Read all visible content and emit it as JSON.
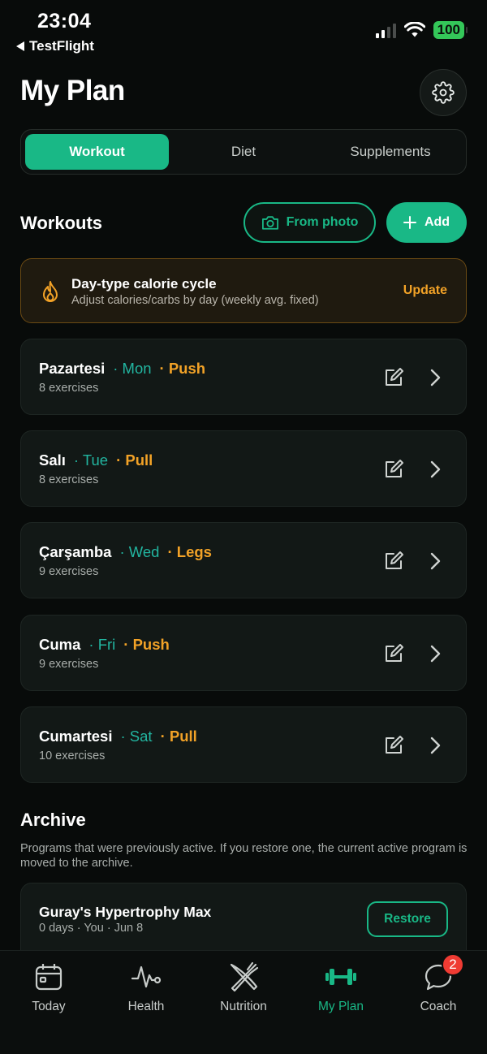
{
  "status": {
    "time": "23:04",
    "back_label": "TestFlight",
    "battery": "100"
  },
  "header": {
    "title": "My Plan"
  },
  "segments": [
    {
      "label": "Workout",
      "active": true
    },
    {
      "label": "Diet",
      "active": false
    },
    {
      "label": "Supplements",
      "active": false
    }
  ],
  "workouts_section": {
    "title": "Workouts",
    "from_photo_label": "From photo",
    "add_label": "Add"
  },
  "calorie_card": {
    "title": "Day-type calorie cycle",
    "subtitle": "Adjust calories/carbs by day (weekly avg. fixed)",
    "action_label": "Update"
  },
  "workouts": [
    {
      "name": "Pazartesi",
      "day": "· Mon",
      "type": "· Push",
      "exercises": "8 exercises"
    },
    {
      "name": "Salı",
      "day": "· Tue",
      "type": "· Pull",
      "exercises": "8 exercises"
    },
    {
      "name": "Çarşamba",
      "day": "· Wed",
      "type": "· Legs",
      "exercises": "9 exercises"
    },
    {
      "name": "Cuma",
      "day": "· Fri",
      "type": "· Push",
      "exercises": "9 exercises"
    },
    {
      "name": "Cumartesi",
      "day": "· Sat",
      "type": "· Pull",
      "exercises": "10 exercises"
    }
  ],
  "archive": {
    "title": "Archive",
    "note": "Programs that were previously active. If you restore one, the current active program is moved to the archive.",
    "items": [
      {
        "title": "Guray's Hypertrophy Max",
        "meta": "0 days · You · Jun 8",
        "action_label": "Restore"
      }
    ]
  },
  "tabbar": {
    "items": [
      {
        "label": "Today",
        "icon": "calendar-icon",
        "active": false
      },
      {
        "label": "Health",
        "icon": "heartbeat-icon",
        "active": false
      },
      {
        "label": "Nutrition",
        "icon": "fork-knife-icon",
        "active": false
      },
      {
        "label": "My Plan",
        "icon": "dumbbell-icon",
        "active": true
      },
      {
        "label": "Coach",
        "icon": "chat-icon",
        "active": false,
        "badge": "2"
      }
    ]
  },
  "colors": {
    "accent": "#19b886",
    "warning": "#f2a227",
    "teal": "#22b5a0",
    "badge": "#ef3b33"
  }
}
